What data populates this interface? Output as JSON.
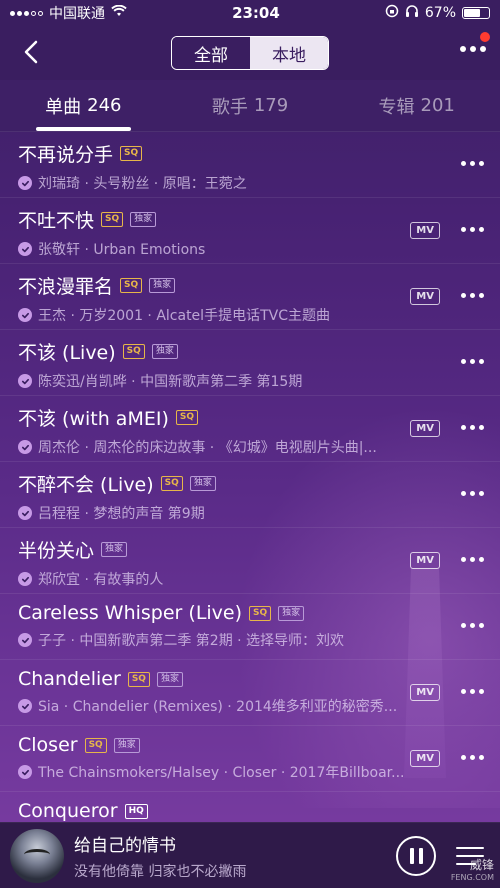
{
  "status_bar": {
    "carrier": "中国联通",
    "time": "23:04",
    "battery": "67%",
    "battery_level": 0.67
  },
  "header": {
    "segments": [
      {
        "label": "全部",
        "active": true
      },
      {
        "label": "本地",
        "active": false
      }
    ]
  },
  "tabs": [
    {
      "label": "单曲",
      "count": "246",
      "active": true
    },
    {
      "label": "歌手",
      "count": "179",
      "active": false
    },
    {
      "label": "专辑",
      "count": "201",
      "active": false
    }
  ],
  "songs": [
    {
      "title": "不再说分手",
      "badges": [
        "SQ"
      ],
      "subtitle": "刘瑞琦 · 头号粉丝 · 原唱：王菀之",
      "mv": false
    },
    {
      "title": "不吐不快",
      "badges": [
        "SQ",
        "独家"
      ],
      "subtitle": "张敬轩 · Urban Emotions",
      "mv": true
    },
    {
      "title": "不浪漫罪名",
      "badges": [
        "SQ",
        "独家"
      ],
      "subtitle": "王杰 · 万岁2001 · Alcatel手提电话TVC主题曲",
      "mv": true
    },
    {
      "title": "不该 (Live)",
      "badges": [
        "SQ",
        "独家"
      ],
      "subtitle": "陈奕迅/肖凯晔 · 中国新歌声第二季 第15期",
      "mv": false
    },
    {
      "title": "不该 (with aMEI)",
      "badges": [
        "SQ"
      ],
      "subtitle": "周杰伦 · 周杰伦的床边故事 · 《幻城》电视剧片头曲|...",
      "mv": true
    },
    {
      "title": "不醉不会 (Live)",
      "badges": [
        "SQ",
        "独家"
      ],
      "subtitle": "吕程程 · 梦想的声音 第9期",
      "mv": false
    },
    {
      "title": "半份关心",
      "badges": [
        "独家"
      ],
      "subtitle": "郑欣宜 · 有故事的人",
      "mv": true
    },
    {
      "title": "Careless Whisper (Live)",
      "badges": [
        "SQ",
        "独家"
      ],
      "subtitle": "子子 · 中国新歌声第二季 第2期 · 选择导师：刘欢",
      "mv": false
    },
    {
      "title": "Chandelier",
      "badges": [
        "SQ",
        "独家"
      ],
      "subtitle": "Sia · Chandelier (Remixes) · 2014维多利亚的秘密秀...",
      "mv": true
    },
    {
      "title": "Closer",
      "badges": [
        "SQ",
        "独家"
      ],
      "subtitle": "The Chainsmokers/Halsey · Closer · 2017年Billboar...",
      "mv": true
    },
    {
      "title": "Conqueror",
      "badges": [
        "HQ"
      ],
      "subtitle": "",
      "mv": false
    }
  ],
  "labels": {
    "mv": "MV"
  },
  "player": {
    "title": "给自己的情书",
    "subtitle": "没有他倚靠 归家也不必撇雨"
  },
  "watermark": {
    "text": "威锋",
    "small": "FENG.COM"
  }
}
